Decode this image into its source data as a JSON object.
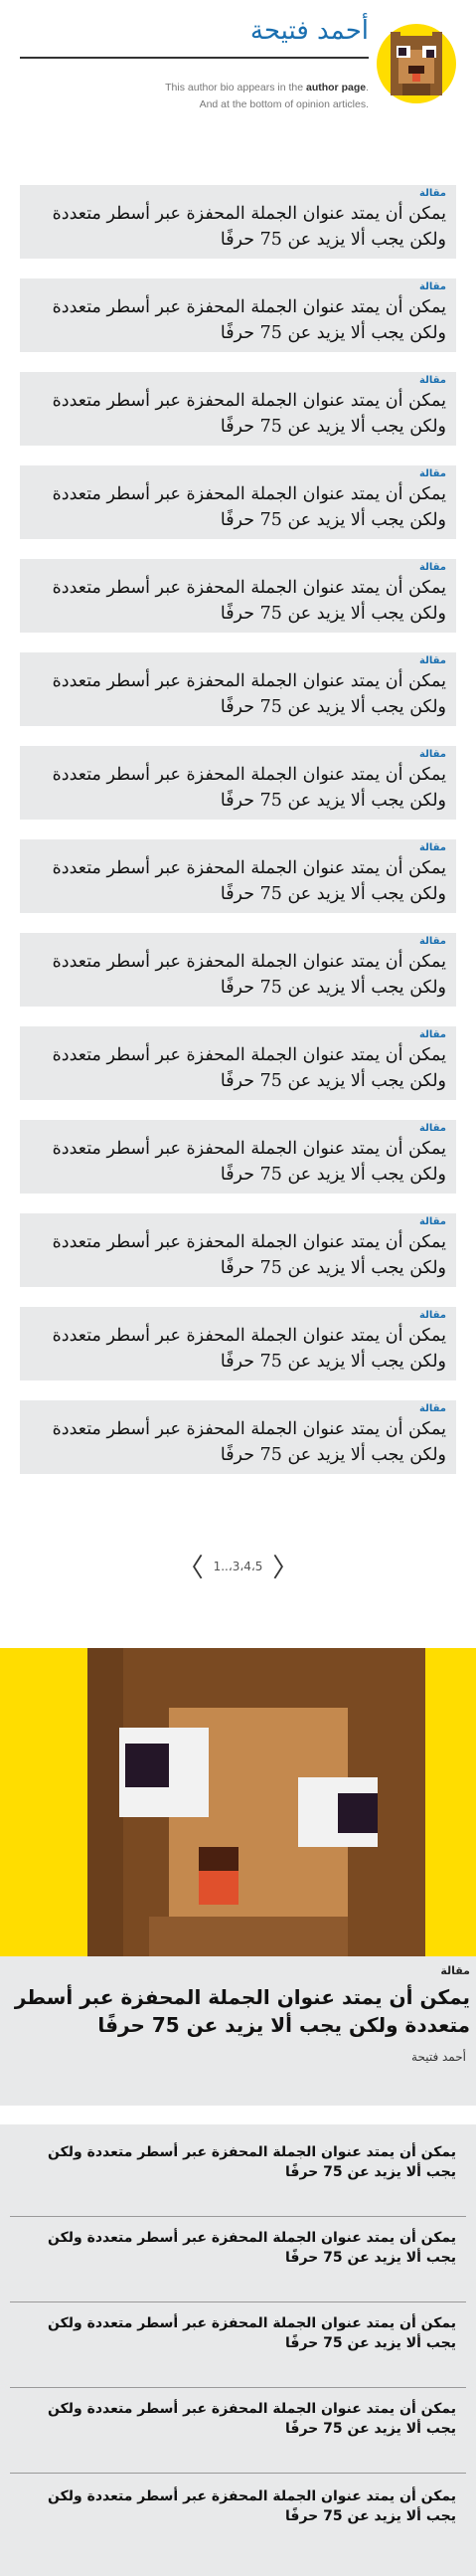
{
  "author": {
    "name": "أحمد فتيحة",
    "bio_line1_pre": "This author bio appears in the ",
    "bio_line1_strong": "author page",
    "bio_line1_post": ".",
    "bio_line2": "And at the bottom of opinion articles."
  },
  "articles": [
    {
      "kicker": "مقالة",
      "title": "يمكن أن يمتد عنوان الجملة المحفزة عبر أسطر متعددة ولكن يجب ألا يزيد عن 75 حرفًا"
    },
    {
      "kicker": "مقالة",
      "title": "يمكن أن يمتد عنوان الجملة المحفزة عبر أسطر متعددة ولكن يجب ألا يزيد عن 75 حرفًا"
    },
    {
      "kicker": "مقالة",
      "title": "يمكن أن يمتد عنوان الجملة المحفزة عبر أسطر متعددة ولكن يجب ألا يزيد عن 75 حرفًا"
    },
    {
      "kicker": "مقالة",
      "title": "يمكن أن يمتد عنوان الجملة المحفزة عبر أسطر متعددة ولكن يجب ألا يزيد عن 75 حرفًا"
    },
    {
      "kicker": "مقالة",
      "title": "يمكن أن يمتد عنوان الجملة المحفزة عبر أسطر متعددة ولكن يجب ألا يزيد عن 75 حرفًا"
    },
    {
      "kicker": "مقالة",
      "title": "يمكن أن يمتد عنوان الجملة المحفزة عبر أسطر متعددة ولكن يجب ألا يزيد عن 75 حرفًا"
    },
    {
      "kicker": "مقالة",
      "title": "يمكن أن يمتد عنوان الجملة المحفزة عبر أسطر متعددة ولكن يجب ألا يزيد عن 75 حرفًا"
    },
    {
      "kicker": "مقالة",
      "title": "يمكن أن يمتد عنوان الجملة المحفزة عبر أسطر متعددة ولكن يجب ألا يزيد عن 75 حرفًا"
    },
    {
      "kicker": "مقالة",
      "title": "يمكن أن يمتد عنوان الجملة المحفزة عبر أسطر متعددة ولكن يجب ألا يزيد عن 75 حرفًا"
    },
    {
      "kicker": "مقالة",
      "title": "يمكن أن يمتد عنوان الجملة المحفزة عبر أسطر متعددة ولكن يجب ألا يزيد عن 75 حرفًا"
    },
    {
      "kicker": "مقالة",
      "title": "يمكن أن يمتد عنوان الجملة المحفزة عبر أسطر متعددة ولكن يجب ألا يزيد عن 75 حرفًا"
    },
    {
      "kicker": "مقالة",
      "title": "يمكن أن يمتد عنوان الجملة المحفزة عبر أسطر متعددة ولكن يجب ألا يزيد عن 75 حرفًا"
    },
    {
      "kicker": "مقالة",
      "title": "يمكن أن يمتد عنوان الجملة المحفزة عبر أسطر متعددة ولكن يجب ألا يزيد عن 75 حرفًا"
    },
    {
      "kicker": "مقالة",
      "title": "يمكن أن يمتد عنوان الجملة المحفزة عبر أسطر متعددة ولكن يجب ألا يزيد عن 75 حرفًا"
    }
  ],
  "pagination": {
    "prev_icon": "chevron-left-icon",
    "next_icon": "chevron-right-icon",
    "pages_text": "1..،3،4،5"
  },
  "featured": {
    "kicker": "مقالة",
    "title": "يمكن أن يمتد عنوان الجملة المحفزة عبر أسطر متعددة ولكن يجب ألا يزيد عن 75 حرفًا",
    "author": "أحمد فتيحة",
    "image_background": "#ffdd00"
  },
  "related": [
    {
      "title": "يمكن أن يمتد عنوان الجملة المحفزة عبر أسطر متعددة ولكن يجب ألا يزيد عن 75 حرفًا"
    },
    {
      "title": "يمكن أن يمتد عنوان الجملة المحفزة عبر أسطر متعددة ولكن يجب ألا يزيد عن 75 حرفًا"
    },
    {
      "title": "يمكن أن يمتد عنوان الجملة المحفزة عبر أسطر متعددة ولكن يجب ألا يزيد عن 75 حرفًا"
    },
    {
      "title": "يمكن أن يمتد عنوان الجملة المحفزة عبر أسطر متعددة ولكن يجب ألا يزيد عن 75 حرفًا"
    },
    {
      "title": "يمكن أن يمتد عنوان الجملة المحفزة عبر أسطر متعددة ولكن يجب ألا يزيد عن 75 حرفًا"
    }
  ],
  "colors": {
    "accent": "#1a6fb0",
    "card_background": "#e8e9ea",
    "avatar_background": "#ffdd00"
  }
}
